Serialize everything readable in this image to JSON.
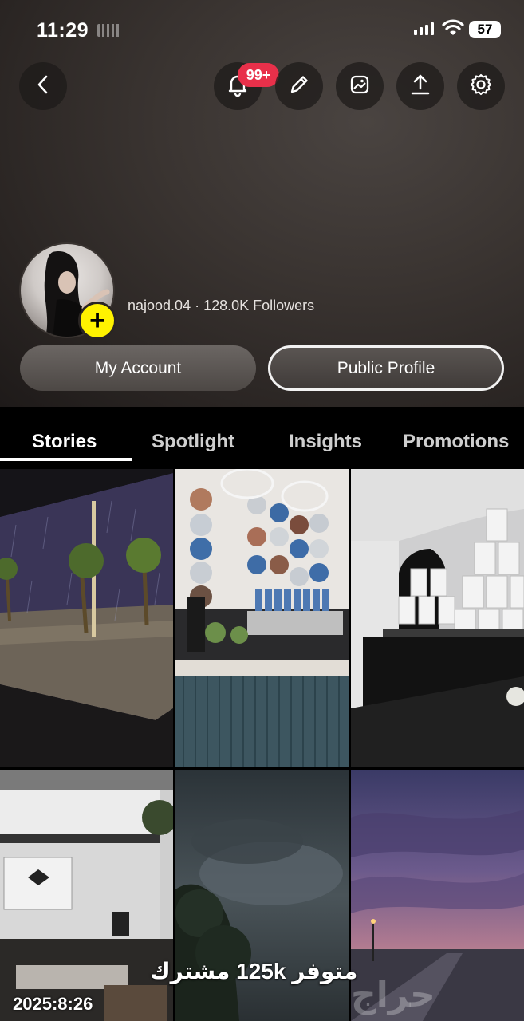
{
  "status_bar": {
    "time": "11:29",
    "battery": "57"
  },
  "header": {
    "notification_badge": "99+",
    "buttons": [
      "back-icon",
      "bell-icon",
      "pencil-icon",
      "photo-icon",
      "share-upload-icon",
      "gear-icon"
    ]
  },
  "profile": {
    "username": "najood.04",
    "separator": "·",
    "followers": "128.0K Followers",
    "my_account_label": "My Account",
    "public_profile_label": "Public Profile"
  },
  "tabs": [
    {
      "label": "Stories",
      "active": true
    },
    {
      "label": "Spotlight",
      "active": false
    },
    {
      "label": "Insights",
      "active": false
    },
    {
      "label": "Promotions",
      "active": false
    }
  ],
  "overlay": {
    "caption": "متوفر 125k مشترك",
    "date": "2025:8:26",
    "watermark": "حراج"
  },
  "colors": {
    "badge": "#e8304a",
    "add_button": "#fff200",
    "background": "#000000"
  }
}
